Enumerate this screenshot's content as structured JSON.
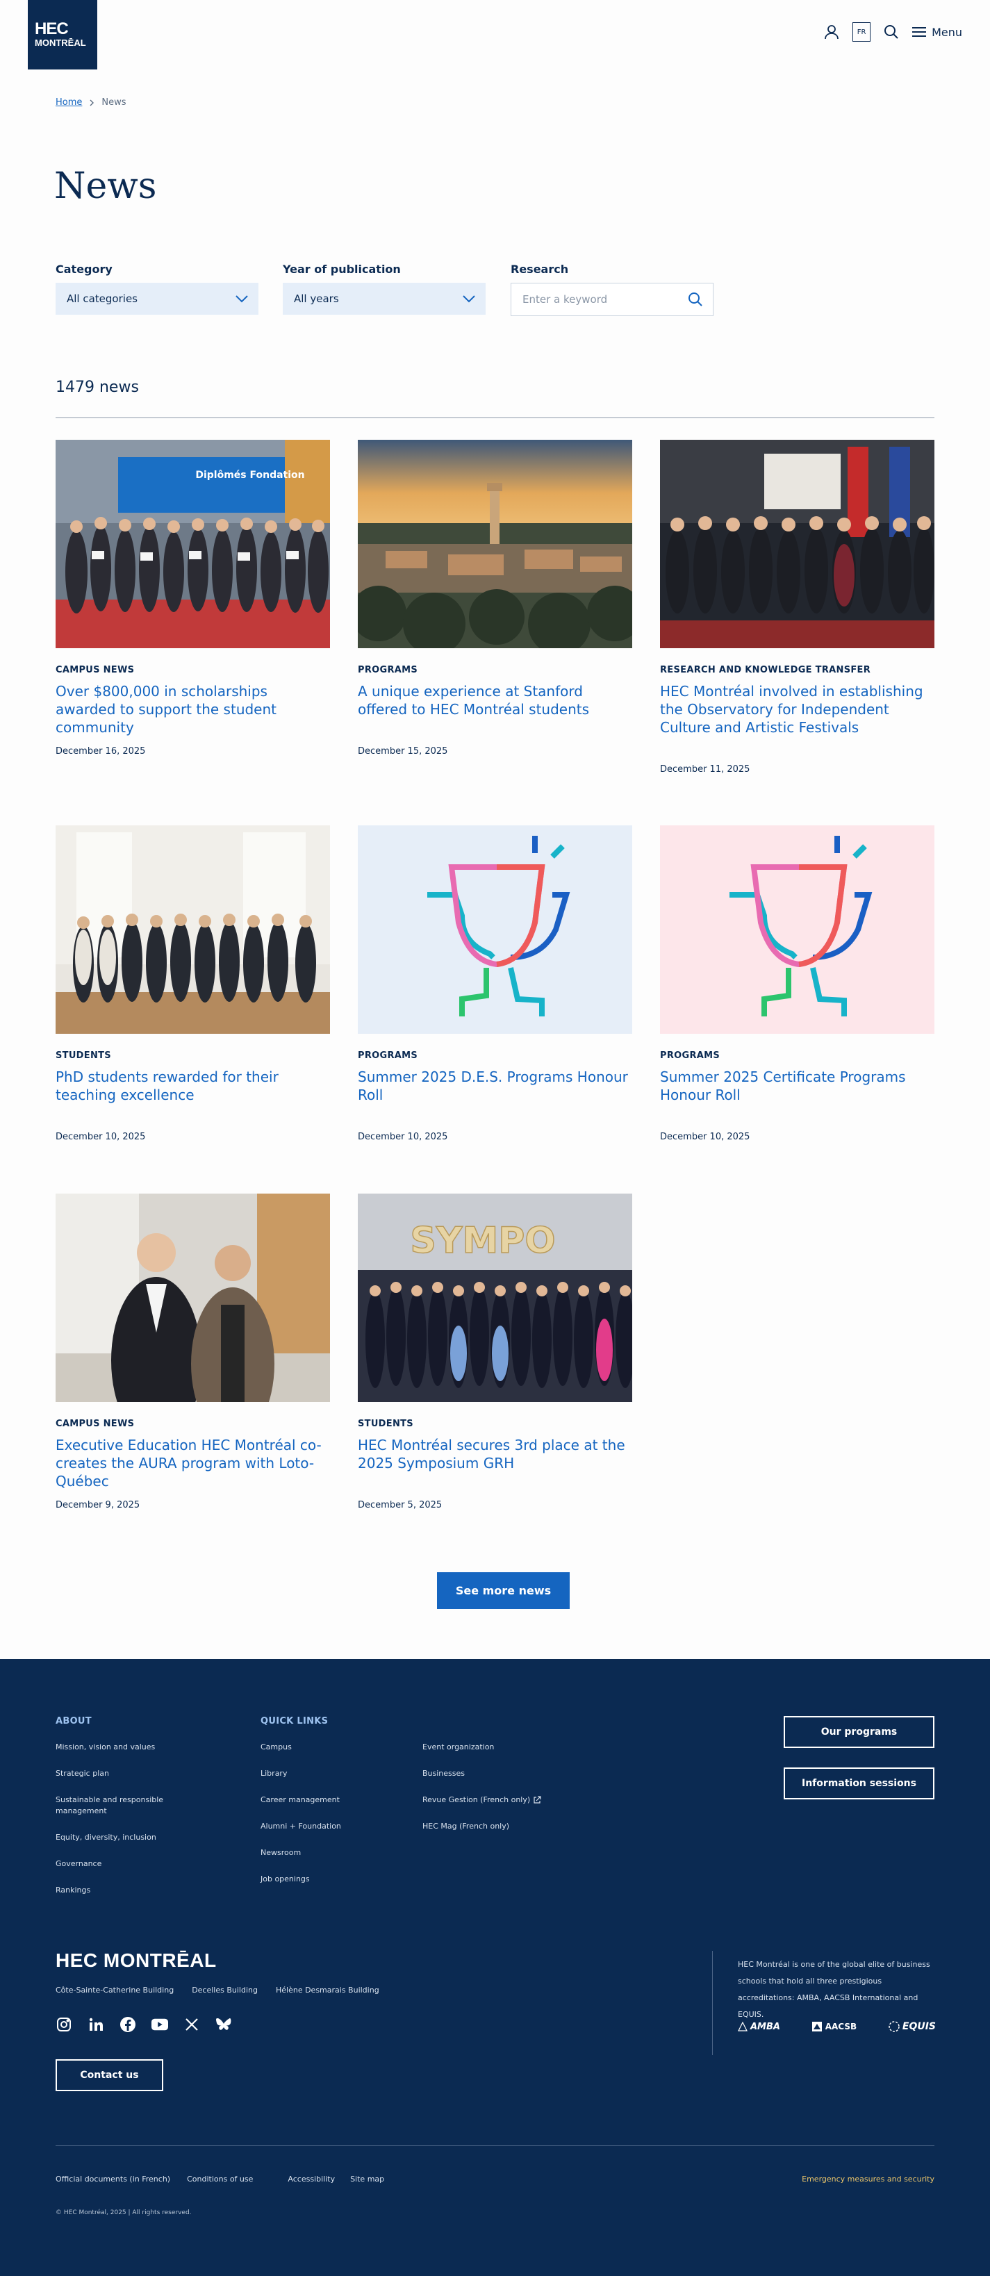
{
  "header": {
    "logo_line1": "HEC",
    "logo_line2": "MONTRĒAL",
    "lang": "FR",
    "menu_label": "Menu",
    "icons": [
      "user-icon",
      "search-icon",
      "hamburger-icon"
    ]
  },
  "breadcrumb": {
    "home": "Home",
    "current": "News"
  },
  "page_title": "News",
  "filters": {
    "category": {
      "label": "Category",
      "value": "All categories"
    },
    "year": {
      "label": "Year of publication",
      "value": "All years"
    },
    "search": {
      "label": "Research",
      "placeholder": "Enter a keyword"
    }
  },
  "results_count": "1479 news",
  "articles": [
    {
      "category": "CAMPUS NEWS",
      "title": "Over $800,000 in scholarships awarded to support the student community",
      "date": "December 16, 2025",
      "image": "Group photo with scholarship certificates",
      "banner_text": "Diplômés Fondation"
    },
    {
      "category": "PROGRAMS",
      "title": "A unique experience at Stanford offered to HEC Montréal students",
      "date": "December 15, 2025",
      "image": "Aerial view of Stanford campus at sunset"
    },
    {
      "category": "RESEARCH AND KNOWLEDGE TRANSFER",
      "title": "HEC Montréal involved in establishing the Observatory for Independent Culture and Artistic Festivals",
      "date": "December 11, 2025",
      "image": "Group photo in front of flags"
    },
    {
      "category": "STUDENTS",
      "title": "PhD students rewarded for their teaching excellence",
      "date": "December 10, 2025",
      "image": "Group photo of PhD students"
    },
    {
      "category": "PROGRAMS",
      "title": "Summer 2025 D.E.S. Programs Honour Roll",
      "date": "December 10, 2025",
      "image": "Trophy illustration on blue background"
    },
    {
      "category": "PROGRAMS",
      "title": "Summer 2025 Certificate Programs Honour Roll",
      "date": "December 10, 2025",
      "image": "Trophy illustration on pink background"
    },
    {
      "category": "CAMPUS NEWS",
      "title": "Executive Education HEC Montréal co-creates the AURA program with Loto-Québec",
      "date": "December 9, 2025",
      "image": "Two men in suits"
    },
    {
      "category": "STUDENTS",
      "title": "HEC Montréal secures 3rd place at the 2025 Symposium GRH",
      "date": "December 5, 2025",
      "image": "Large group photo at symposium",
      "banner_text": "SYMPO"
    }
  ],
  "see_more": "See more news",
  "footer": {
    "about": {
      "heading": "ABOUT",
      "links": [
        "Mission, vision and values",
        "Strategic plan",
        "Sustainable and responsible management",
        "Equity, diversity, inclusion",
        "Governance",
        "Rankings"
      ]
    },
    "quick_links": {
      "heading": "QUICK LINKS",
      "col1": [
        "Campus",
        "Library",
        "Career management",
        "Alumni + Foundation",
        "Newsroom",
        "Job openings"
      ],
      "col2": [
        "Event organization",
        "Businesses",
        "Revue Gestion (French only)",
        "HEC Mag (French only)"
      ]
    },
    "buttons": {
      "programs": "Our programs",
      "sessions": "Information sessions"
    },
    "logo": "HEC MONTRĒAL",
    "buildings": [
      "Côte-Sainte-Catherine Building",
      "Decelles Building",
      "Hélène Desmarais Building"
    ],
    "social_icons": [
      "instagram-icon",
      "linkedin-icon",
      "facebook-icon",
      "youtube-icon",
      "x-icon",
      "bluesky-icon"
    ],
    "contact": "Contact us",
    "accreditation_text": "HEC Montréal is one of the global elite of business schools that hold all three prestigious accreditations: AMBA, AACSB International and EQUIS.",
    "accreditations": [
      "AMBA",
      "AACSB",
      "EQUIS"
    ],
    "bottom_links": [
      "Official documents (in French)",
      "Conditions of use",
      "Accessibility",
      "Site map"
    ],
    "emergency": "Emergency measures and security",
    "copyright": "© HEC Montréal, 2025 | All rights reserved."
  }
}
